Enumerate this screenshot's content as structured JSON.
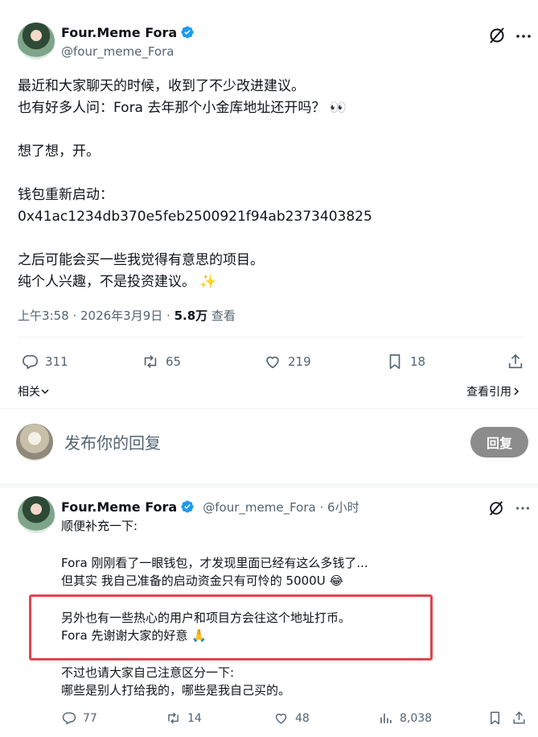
{
  "tweet": {
    "display_name": "Four.Meme Fora",
    "handle": "@four_meme_Fora",
    "lines": [
      "最近和大家聊天的时候，收到了不少改进建议。",
      "也有好多人问：Fora 去年那个小金库地址还开吗？ 👀",
      "",
      "想了想，开。",
      "",
      "钱包重新启动：",
      "0x41ac1234db370e5feb2500921f94ab2373403825",
      "",
      "之后可能会买一些我觉得有意思的项目。",
      "纯个人兴趣，不是投资建议。 ✨"
    ],
    "time": "上午3:58 · 2026年3月9日 · ",
    "views": "5.8万",
    "views_label": " 查看",
    "replies": "311",
    "retweets": "65",
    "likes": "219",
    "bookmarks": "18",
    "related_label": "相关",
    "quotes_label": "查看引用"
  },
  "composer": {
    "placeholder": "发布你的回复",
    "button": "回复"
  },
  "reply": {
    "display_name": "Four.Meme Fora",
    "handle": "@four_meme_Fora",
    "time": " · 6小时",
    "intro": "顺便补充一下:",
    "para1": [
      "Fora 刚刚看了一眼钱包，才发现里面已经有这么多钱了...",
      "但其实 我自己准备的启动资金只有可怜的 5000U 😂"
    ],
    "para2": [
      "另外也有一些热心的用户和项目方会往这个地址打币。",
      "Fora 先谢谢大家的好意 🙏"
    ],
    "para3": [
      "不过也请大家自己注意区分一下:",
      "哪些是别人打给我的，哪些是我自己买的。"
    ],
    "replies": "77",
    "retweets": "14",
    "likes": "48",
    "views": "8,038"
  },
  "colors": {
    "verified": "#1d9bf0",
    "highlight": "#e0454d",
    "muted": "#536471"
  }
}
